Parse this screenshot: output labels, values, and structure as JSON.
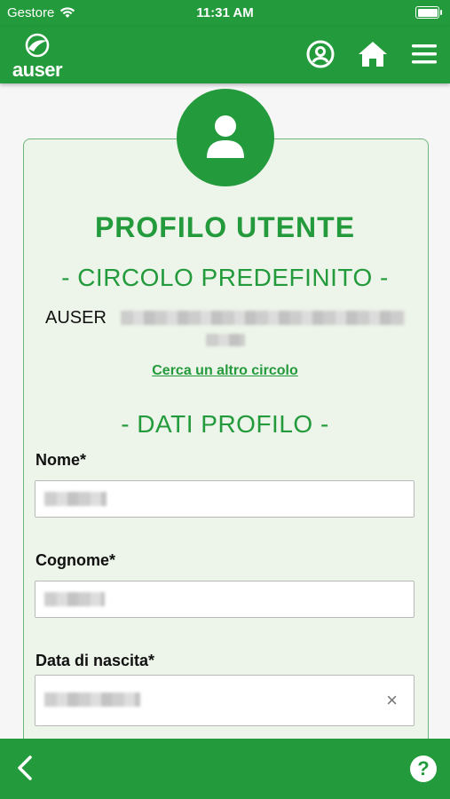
{
  "status_bar": {
    "carrier": "Gestore",
    "time": "11:31 AM"
  },
  "header": {
    "logo_text": "auser",
    "icons": [
      "user-circle-icon",
      "home-icon",
      "hamburger-menu-icon"
    ]
  },
  "profile": {
    "title": "PROFILO UTENTE",
    "circolo_heading": "- CIRCOLO PREDEFINITO -",
    "circolo_prefix": "AUSER",
    "change_circolo_link": "Cerca un altro circolo",
    "dati_heading": "- DATI PROFILO -"
  },
  "form": {
    "nome_label": "Nome*",
    "cognome_label": "Cognome*",
    "nascita_label": "Data di nascita*"
  },
  "footer": {
    "help_label": "?"
  },
  "colors": {
    "brand_green": "#239a3b",
    "card_bg": "#edf4e9"
  }
}
